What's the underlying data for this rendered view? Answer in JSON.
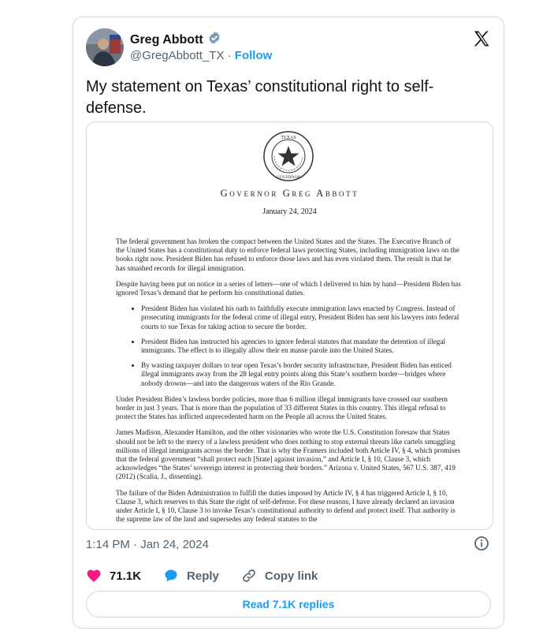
{
  "author": {
    "name": "Greg Abbott",
    "handle": "@GregAbbott_TX",
    "separator": "·",
    "follow_label": "Follow"
  },
  "tweet": {
    "text": "My statement on Texas’ constitutional right to self-defense."
  },
  "document": {
    "seal_text": "THE STATE OF TEXAS · GOVERNOR",
    "header": "Governor Greg Abbott",
    "date": "January 24, 2024",
    "paragraphs": [
      "The federal government has broken the compact between the United States and the States. The Executive Branch of the United States has a constitutional duty to enforce federal laws protecting States, including immigration laws on the books right now. President Biden has refused to enforce those laws and has even violated them. The result is that he has smashed records for illegal immigration.",
      "Despite having been put on notice in a series of letters—one of which I delivered to him by hand—President Biden has ignored Texas’s demand that he perform his constitutional duties."
    ],
    "bullets": [
      "President Biden has violated his oath to faithfully execute immigration laws enacted by Congress. Instead of prosecuting immigrants for the federal crime of illegal entry, President Biden has sent his lawyers into federal courts to sue Texas for taking action to secure the border.",
      "President Biden has instructed his agencies to ignore federal statutes that mandate the detention of illegal immigrants. The effect is to illegally allow their en masse parole into the United States.",
      "By wasting taxpayer dollars to tear open Texas’s border security infrastructure, President Biden has enticed illegal immigrants away from the 28 legal entry points along this State’s southern border—bridges where nobody drowns—and into the dangerous waters of the Rio Grande."
    ],
    "paragraphs2": [
      "Under President Biden’s lawless border policies, more than 6 million illegal immigrants have crossed our southern border in just 3 years. That is more than the population of 33 different States in this country. This illegal refusal to protect the States has inflicted unprecedented harm on the People all across the United States.",
      "James Madison, Alexander Hamilton, and the other visionaries who wrote the U.S. Constitution foresaw that States should not be left to the mercy of a lawless president who does nothing to stop external threats like cartels smuggling millions of illegal immigrants across the border. That is why the Framers included both Article IV, § 4, which promises that the federal government “shall protect each [State] against invasion,” and Article I, § 10, Clause 3, which acknowledges “the States’ sovereign interest in protecting their borders.” Arizona v. United States, 567 U.S. 387, 419 (2012) (Scalia, J., dissenting).",
      "The failure of the Biden Administration to fulfill the duties imposed by Article IV, § 4 has triggered Article I, § 10, Clause 3, which reserves to this State the right of self-defense. For these reasons, I have already declared an invasion under Article I, § 10, Clause 3 to invoke Texas’s constitutional authority to defend and protect itself. That authority is the supreme law of the land and supersedes any federal statutes to the"
    ]
  },
  "timestamp": "1:14 PM · Jan 24, 2024",
  "actions": {
    "likes": "71.1K",
    "reply_label": "Reply",
    "copy_label": "Copy link"
  },
  "read_replies_label": "Read 7.1K replies",
  "colors": {
    "accent": "#1d9bf0",
    "like": "#f91880",
    "muted": "#536471",
    "border": "#cfd9de"
  },
  "icons": [
    "verified-badge-icon",
    "x-logo-icon",
    "info-icon",
    "heart-icon",
    "reply-bubble-icon",
    "link-icon"
  ]
}
